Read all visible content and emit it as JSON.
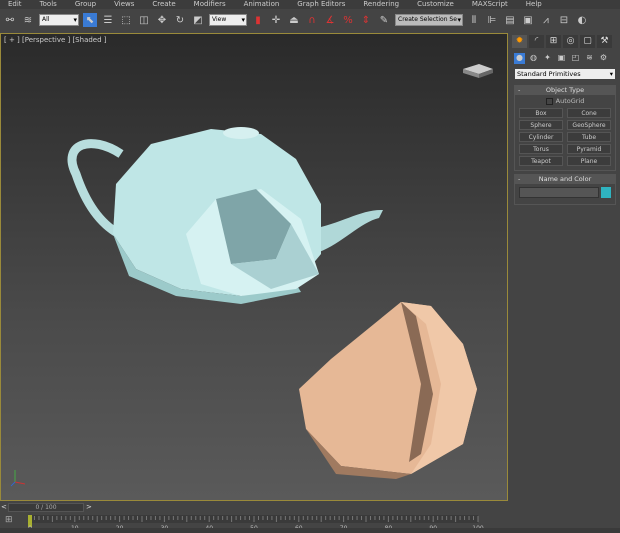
{
  "menu": [
    "Edit",
    "Tools",
    "Group",
    "Views",
    "Create",
    "Modifiers",
    "Animation",
    "Graph Editors",
    "Rendering",
    "Customize",
    "MAXScript",
    "Help"
  ],
  "toolbar": {
    "filter_value": "All",
    "refcoord_value": "View",
    "selection_set_placeholder": "Create Selection Se"
  },
  "viewport": {
    "label": "[ + ] [Perspective ] [Shaded ]",
    "teapot_color": "#bfe6e6",
    "rock_color": "#e6b896"
  },
  "panel": {
    "dropdown": "Standard Primitives",
    "object_type_title": "Object Type",
    "autogrid": "AutoGrid",
    "buttons": [
      "Box",
      "Cone",
      "Sphere",
      "GeoSphere",
      "Cylinder",
      "Tube",
      "Torus",
      "Pyramid",
      "Teapot",
      "Plane"
    ],
    "name_color_title": "Name and Color",
    "color_swatch": "#2fb3c0"
  },
  "timeline": {
    "slider": "0 / 100",
    "ticks": [
      "0",
      "10",
      "20",
      "30",
      "40",
      "50",
      "60",
      "70",
      "80",
      "90",
      "100"
    ]
  }
}
